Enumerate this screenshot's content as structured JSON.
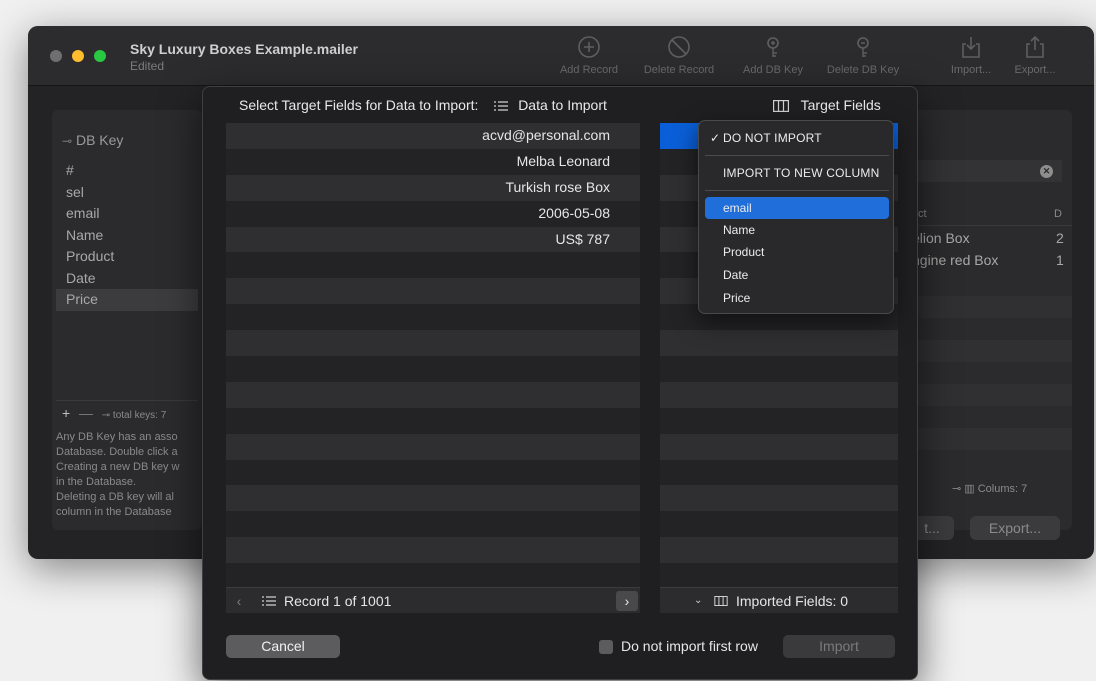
{
  "window": {
    "title": "Sky Luxury Boxes Example.mailer",
    "subtitle": "Edited",
    "toolbar": [
      {
        "label": "Add Record",
        "icon": "plus-circle-icon"
      },
      {
        "label": "Delete Record",
        "icon": "prohibit-icon"
      },
      {
        "label": "Add DB Key",
        "icon": "add-key-icon"
      },
      {
        "label": "Delete DB Key",
        "icon": "delete-key-icon"
      },
      {
        "label": "Import...",
        "icon": "import-icon"
      },
      {
        "label": "Export...",
        "icon": "export-icon"
      }
    ]
  },
  "db_panel": {
    "header": "DB Key",
    "items": [
      "#",
      "sel",
      "email",
      "Name",
      "Product",
      "Date",
      "Price"
    ],
    "selected_index": 6,
    "footer": "total keys: 7",
    "description": [
      "Any DB Key has an asso",
      "Database. Double click a",
      "Creating a new DB key w",
      "in the Database.",
      "Deleting a DB key will al",
      "column in the Database"
    ]
  },
  "right_panel": {
    "header_left": "ct",
    "header_right": "D",
    "rows": [
      {
        "product": "elion Box",
        "d": "2"
      },
      {
        "product": "ngine red Box",
        "d": "1"
      }
    ],
    "footer": "Colums: 7",
    "buttons": [
      "t...",
      "Export..."
    ]
  },
  "sheet": {
    "title": "Select Target Fields for Data to Import:",
    "data_header": "Data to Import",
    "target_header": "Target Fields",
    "data_values": [
      "acvd@personal.com",
      "Melba Leonard",
      "Turkish rose Box",
      "2006-05-08",
      "US$ 787"
    ],
    "record_label": "Record 1 of 1001",
    "imported_fields": "Imported Fields: 0",
    "cancel_label": "Cancel",
    "checkbox_label": "Do not import first row",
    "import_label": "Import"
  },
  "menu": {
    "items": [
      {
        "label": "DO NOT IMPORT",
        "checked": true
      },
      {
        "label": "IMPORT TO NEW COLUMN"
      },
      {
        "label": "email",
        "highlighted": true
      },
      {
        "label": "Name"
      },
      {
        "label": "Product"
      },
      {
        "label": "Date"
      },
      {
        "label": "Price"
      }
    ],
    "check_glyph": "✓"
  },
  "colors": {
    "accent": "#0a5fd8",
    "menu_highlight": "#1f6ed9",
    "traffic_red": "#ff5f57",
    "traffic_yellow": "#febc2e",
    "traffic_green": "#28c840"
  }
}
